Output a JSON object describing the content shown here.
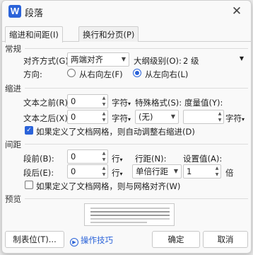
{
  "window": {
    "title": "段落",
    "app_icon_letter": "W"
  },
  "tabs": [
    {
      "label": "缩进和间距(I)",
      "active": true
    },
    {
      "label": "换行和分页(P)",
      "active": false
    }
  ],
  "general": {
    "section_title": "常规",
    "alignment_label": "对齐方式(G):",
    "alignment_value": "两端对齐",
    "outline_label": "大纲级别(O):",
    "outline_value": "2 级",
    "direction_label": "方向:",
    "direction_rtl": "从右向左(F)",
    "direction_ltr": "从左向右(L)",
    "direction_selected": "ltr"
  },
  "indent": {
    "section_title": "缩进",
    "before_label": "文本之前(R):",
    "before_value": "0",
    "before_unit": "字符",
    "after_label": "文本之后(X):",
    "after_value": "0",
    "after_unit": "字符",
    "special_label": "特殊格式(S):",
    "special_value": "(无)",
    "measure_label": "度量值(Y):",
    "measure_value": "",
    "measure_unit": "字符",
    "grid_checkbox_label": "如果定义了文档网格，则自动调整右缩进(D)",
    "grid_checked": true
  },
  "spacing": {
    "section_title": "间距",
    "before_label": "段前(B):",
    "before_value": "0",
    "before_unit": "行",
    "after_label": "段后(E):",
    "after_value": "0",
    "after_unit": "行",
    "line_label": "行距(N):",
    "line_value": "单倍行距",
    "setting_label": "设置值(A):",
    "setting_value": "1",
    "setting_unit": "倍",
    "grid_checkbox_label": "如果定义了文档网格，则与网格对齐(W)",
    "grid_checked": false
  },
  "preview": {
    "section_title": "预览"
  },
  "footer": {
    "tabs_button": "制表位(T)...",
    "tips_link": "操作技巧",
    "ok_button": "确定",
    "cancel_button": "取消"
  },
  "colors": {
    "accent": "#2b63d9"
  }
}
